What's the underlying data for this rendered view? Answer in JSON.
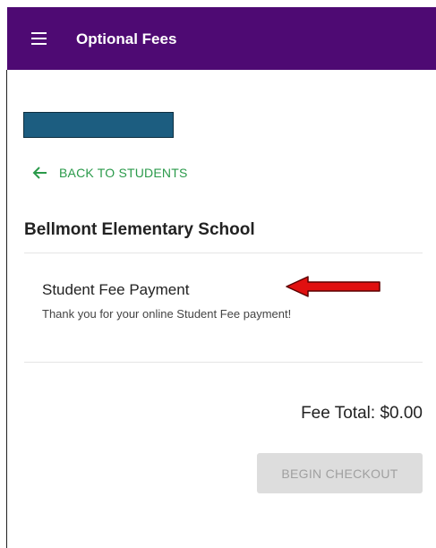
{
  "header": {
    "title": "Optional Fees",
    "menu_icon": "hamburger-menu-icon",
    "background_color": "#4e0a73"
  },
  "student_selector": {
    "redacted_color": "#1c5d80"
  },
  "back_link": {
    "label": "BACK TO STUDENTS",
    "icon": "arrow-left-icon",
    "color": "#2a9a4a"
  },
  "school": {
    "name": "Bellmont Elementary School"
  },
  "fee_item": {
    "title": "Student Fee Payment",
    "description": "Thank you for your online Student Fee payment!",
    "annotation_icon": "red-arrow-icon",
    "annotation_color": "#e01010"
  },
  "summary": {
    "fee_total": "Fee Total: $0.00"
  },
  "checkout": {
    "label": "BEGIN CHECKOUT",
    "disabled": true
  }
}
